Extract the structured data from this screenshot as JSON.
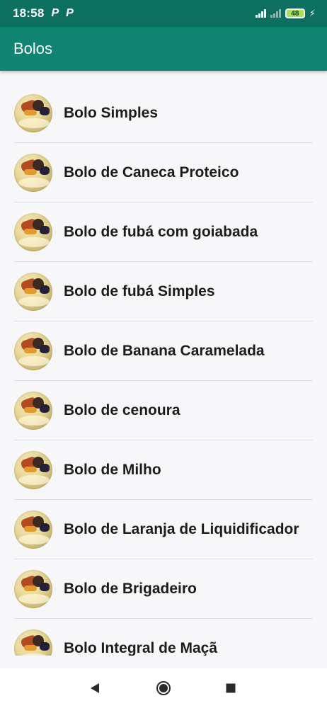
{
  "status_bar": {
    "time": "18:58",
    "notifications": [
      "P",
      "P"
    ],
    "battery": "48",
    "colors": {
      "background": "#0c6f5f",
      "battery_fill": "#a8e05a"
    },
    "icons": [
      "signal-icon",
      "signal-no-service-icon",
      "battery-icon",
      "charging-icon"
    ]
  },
  "app_bar": {
    "title": "Bolos",
    "color": "#0f8472"
  },
  "recipes": [
    {
      "name": "Bolo Simples"
    },
    {
      "name": "Bolo de Caneca Proteico"
    },
    {
      "name": "Bolo de fubá com goiabada"
    },
    {
      "name": "Bolo de fubá Simples"
    },
    {
      "name": "Bolo de Banana Caramelada"
    },
    {
      "name": "Bolo de cenoura"
    },
    {
      "name": "Bolo de Milho"
    },
    {
      "name": "Bolo de Laranja de Liquidificador"
    },
    {
      "name": "Bolo de Brigadeiro"
    },
    {
      "name": "Bolo Integral de Maçã"
    }
  ],
  "nav_bar": {
    "icons": [
      "back-icon",
      "home-icon",
      "recent-apps-icon"
    ]
  }
}
